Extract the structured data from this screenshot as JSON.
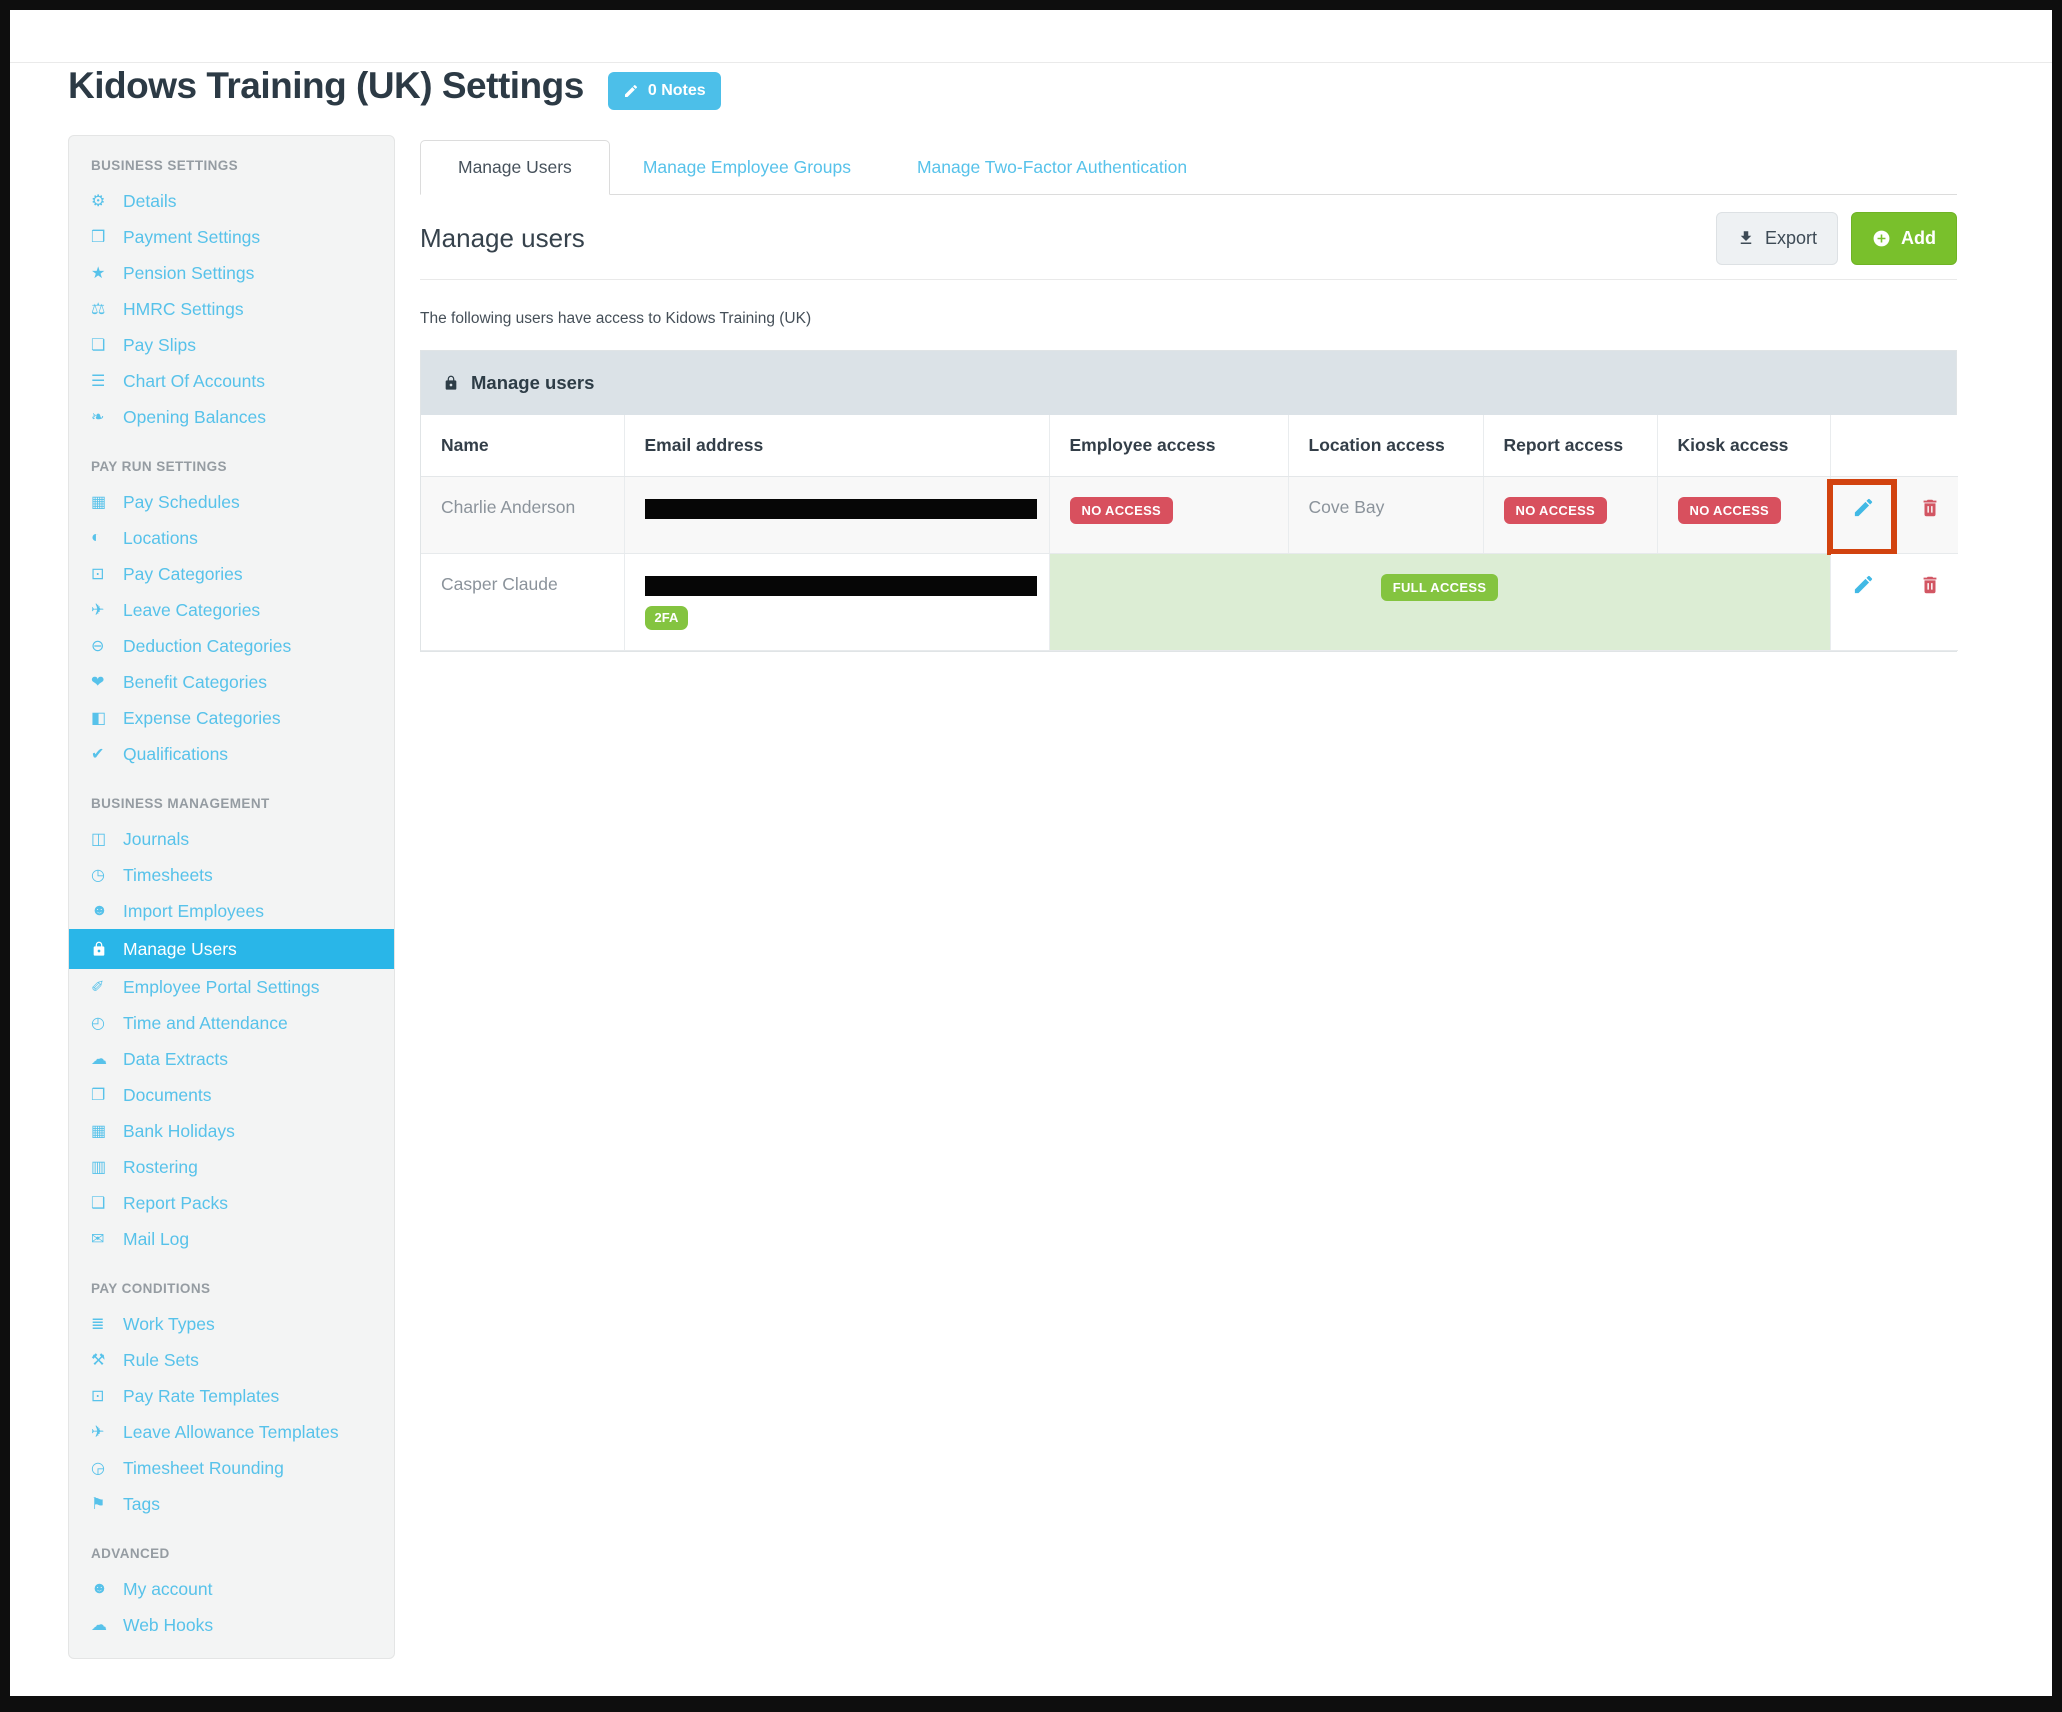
{
  "window": {
    "title": "Kidows Training (UK) Settings",
    "notes_badge": "0 Notes"
  },
  "sidebar": {
    "sections": [
      {
        "label": "BUSINESS SETTINGS",
        "items": [
          {
            "label": "Details",
            "icon": "gear-icon",
            "glyph": "⚙"
          },
          {
            "label": "Payment Settings",
            "icon": "save-icon",
            "glyph": "❒"
          },
          {
            "label": "Pension Settings",
            "icon": "star-icon",
            "glyph": "★"
          },
          {
            "label": "HMRC Settings",
            "icon": "scales-icon",
            "glyph": "⚖"
          },
          {
            "label": "Pay Slips",
            "icon": "payslip-icon",
            "glyph": "❏"
          },
          {
            "label": "Chart Of Accounts",
            "icon": "list-icon",
            "glyph": "☰"
          },
          {
            "label": "Opening Balances",
            "icon": "leaf-icon",
            "glyph": "❧"
          }
        ]
      },
      {
        "label": "PAY RUN SETTINGS",
        "items": [
          {
            "label": "Pay Schedules",
            "icon": "calendar-icon",
            "glyph": "▦"
          },
          {
            "label": "Locations",
            "icon": "globe-icon",
            "glyph": "◐"
          },
          {
            "label": "Pay Categories",
            "icon": "banknote-icon",
            "glyph": "⊡"
          },
          {
            "label": "Leave Categories",
            "icon": "plane-icon",
            "glyph": "✈"
          },
          {
            "label": "Deduction Categories",
            "icon": "minus-circle-icon",
            "glyph": "⊖"
          },
          {
            "label": "Benefit Categories",
            "icon": "hand-heart-icon",
            "glyph": "❤"
          },
          {
            "label": "Expense Categories",
            "icon": "archive-icon",
            "glyph": "◧"
          },
          {
            "label": "Qualifications",
            "icon": "check-icon",
            "glyph": "✔"
          }
        ]
      },
      {
        "label": "BUSINESS MANAGEMENT",
        "items": [
          {
            "label": "Journals",
            "icon": "journal-icon",
            "glyph": "◫"
          },
          {
            "label": "Timesheets",
            "icon": "clock-icon",
            "glyph": "◷"
          },
          {
            "label": "Import Employees",
            "icon": "people-icon",
            "glyph": "☻"
          },
          {
            "label": "Manage Users",
            "icon": "lock-icon",
            "glyph": "",
            "active": true
          },
          {
            "label": "Employee Portal Settings",
            "icon": "wand-icon",
            "glyph": "✐"
          },
          {
            "label": "Time and Attendance",
            "icon": "person-clock-icon",
            "glyph": "◴"
          },
          {
            "label": "Data Extracts",
            "icon": "cloud-download-icon",
            "glyph": "☁"
          },
          {
            "label": "Documents",
            "icon": "folder-icon",
            "glyph": "❐"
          },
          {
            "label": "Bank Holidays",
            "icon": "calendar-icon",
            "glyph": "▦"
          },
          {
            "label": "Rostering",
            "icon": "calendar-clock-icon",
            "glyph": "▥"
          },
          {
            "label": "Report Packs",
            "icon": "folder-open-icon",
            "glyph": "❑"
          },
          {
            "label": "Mail Log",
            "icon": "envelope-icon",
            "glyph": "✉"
          }
        ]
      },
      {
        "label": "PAY CONDITIONS",
        "items": [
          {
            "label": "Work Types",
            "icon": "book-icon",
            "glyph": "≣"
          },
          {
            "label": "Rule Sets",
            "icon": "gavel-icon",
            "glyph": "⚒"
          },
          {
            "label": "Pay Rate Templates",
            "icon": "banknote-icon",
            "glyph": "⊡"
          },
          {
            "label": "Leave Allowance Templates",
            "icon": "plane-icon",
            "glyph": "✈"
          },
          {
            "label": "Timesheet Rounding",
            "icon": "clock-icon",
            "glyph": "◶"
          },
          {
            "label": "Tags",
            "icon": "tag-icon",
            "glyph": "⚑"
          }
        ]
      },
      {
        "label": "ADVANCED",
        "items": [
          {
            "label": "My account",
            "icon": "user-icon",
            "glyph": "☻"
          },
          {
            "label": "Web Hooks",
            "icon": "cloud-icon",
            "glyph": "☁"
          }
        ]
      }
    ]
  },
  "tabs": [
    {
      "label": "Manage Users",
      "active": true
    },
    {
      "label": "Manage Employee Groups",
      "active": false
    },
    {
      "label": "Manage Two-Factor Authentication",
      "active": false
    }
  ],
  "main": {
    "heading": "Manage users",
    "buttons": {
      "export": "Export",
      "add": "Add"
    },
    "intro": "The following users have access to Kidows Training (UK)",
    "panel_title": "Manage users",
    "table": {
      "columns": [
        "Name",
        "Email address",
        "Employee access",
        "Location access",
        "Report access",
        "Kiosk access"
      ],
      "rows": [
        {
          "name": "Charlie Anderson",
          "email_redacted": true,
          "employee_access": "NO ACCESS",
          "location_access": "Cove Bay",
          "report_access": "NO ACCESS",
          "kiosk_access": "NO ACCESS"
        },
        {
          "name": "Casper Claude",
          "email_redacted": true,
          "two_fa_badge": "2FA",
          "access_summary": "FULL ACCESS"
        }
      ]
    }
  },
  "annotation": {
    "description": "orange highlight box around edit action of first row",
    "color": "#d2430f"
  },
  "colors": {
    "accent_blue": "#29b6e8",
    "link_blue": "#57c2ea",
    "notes_badge_blue": "#4cbfe9",
    "add_green": "#79c02c",
    "badge_green": "#84c440",
    "badge_red": "#d8505e",
    "row_full_access_bg": "#dcedd4",
    "panel_header_bg": "#dbe2e7",
    "annotation_orange": "#d2430f",
    "edit_icon_blue": "#41b9e5",
    "delete_icon_red": "#d25663"
  }
}
